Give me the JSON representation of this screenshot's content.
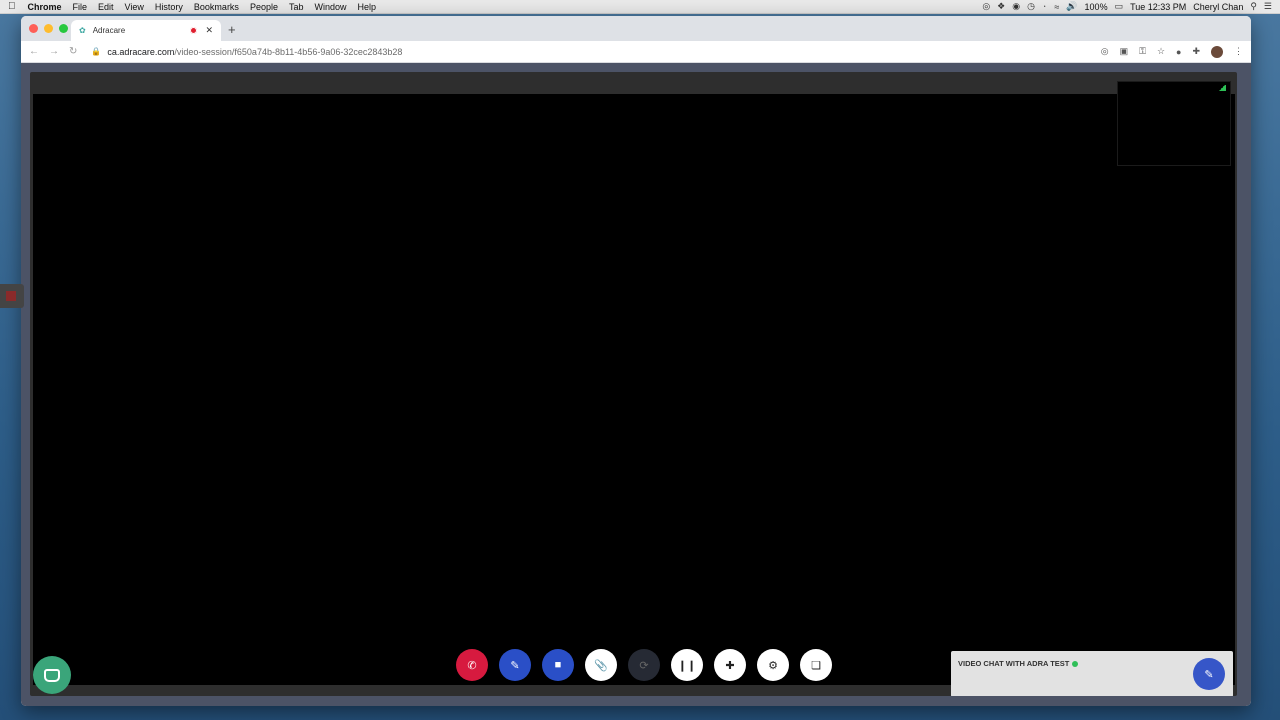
{
  "menubar": {
    "apple": "",
    "items": [
      "Chrome",
      "File",
      "Edit",
      "View",
      "History",
      "Bookmarks",
      "People",
      "Tab",
      "Window",
      "Help"
    ],
    "battery": "100%",
    "clock": "Tue 12:33 PM",
    "user": "Cheryl Chan"
  },
  "browser": {
    "tab_title": "Adracare",
    "url_host": "ca.adracare.com",
    "url_path": "/video-session/f650a74b-8b11-4b56-9a06-32cec2843b28"
  },
  "chat": {
    "title": "VIDEO CHAT WITH ADRA TEST"
  },
  "colors": {
    "hangup": "#d71a3f",
    "control_blue": "#2a4fc7",
    "online": "#2fbf58",
    "support": "#3aa57a"
  }
}
